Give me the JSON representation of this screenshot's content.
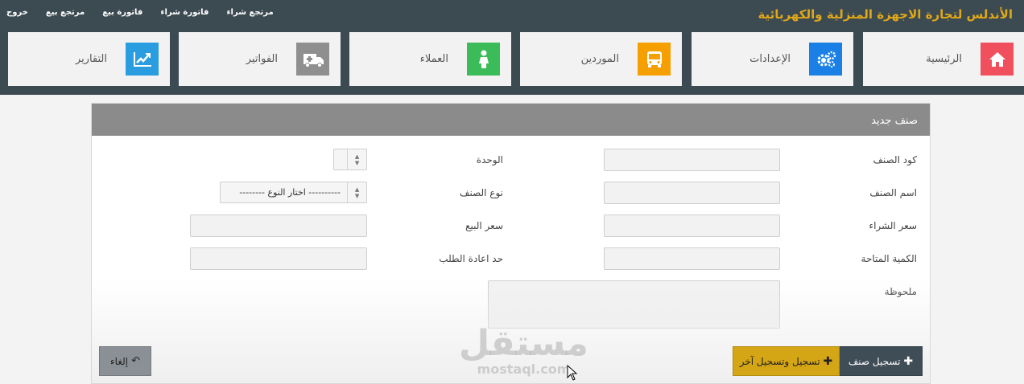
{
  "header": {
    "brand": "الأندلس لتجارة الاجهزة المنزلية والكهربائية",
    "links": [
      "مرتجع شراء",
      "فاتورة شراء",
      "فاتورة بيع",
      "مرتجع بيع",
      "خروج"
    ]
  },
  "tiles": [
    {
      "label": "الرئيسية",
      "color": "#f0505e",
      "icon": "home-icon"
    },
    {
      "label": "الإعدادات",
      "color": "#1a80e6",
      "icon": "gears-icon"
    },
    {
      "label": "الموردين",
      "color": "#f5a000",
      "icon": "bus-icon"
    },
    {
      "label": "العملاء",
      "color": "#3cbc58",
      "icon": "person-icon"
    },
    {
      "label": "الفواتير",
      "color": "#8f8f8f",
      "icon": "ambulance-icon"
    },
    {
      "label": "التقارير",
      "color": "#2a9de0",
      "icon": "chart-icon"
    }
  ],
  "panel": {
    "title": "صنف جديد",
    "fields": {
      "item_code": "كود الصنف",
      "unit": "الوحدة",
      "item_name": "اسم الصنف",
      "item_type": "نوع الصنف",
      "purchase_price": "سعر الشراء",
      "sale_price": "سعر البيع",
      "available_qty": "الكمية المتاحة",
      "reorder_limit": "حد اعادة الطلب",
      "note": "ملحوظة"
    },
    "type_select": "---------- اختار النوع --------",
    "buttons": {
      "save": "تسجيل صنف",
      "save_new": "تسجيل وتسجيل آخر",
      "cancel": "إلغاء"
    }
  },
  "watermark": {
    "main": "مستقل",
    "sub": "mostaql.com"
  }
}
